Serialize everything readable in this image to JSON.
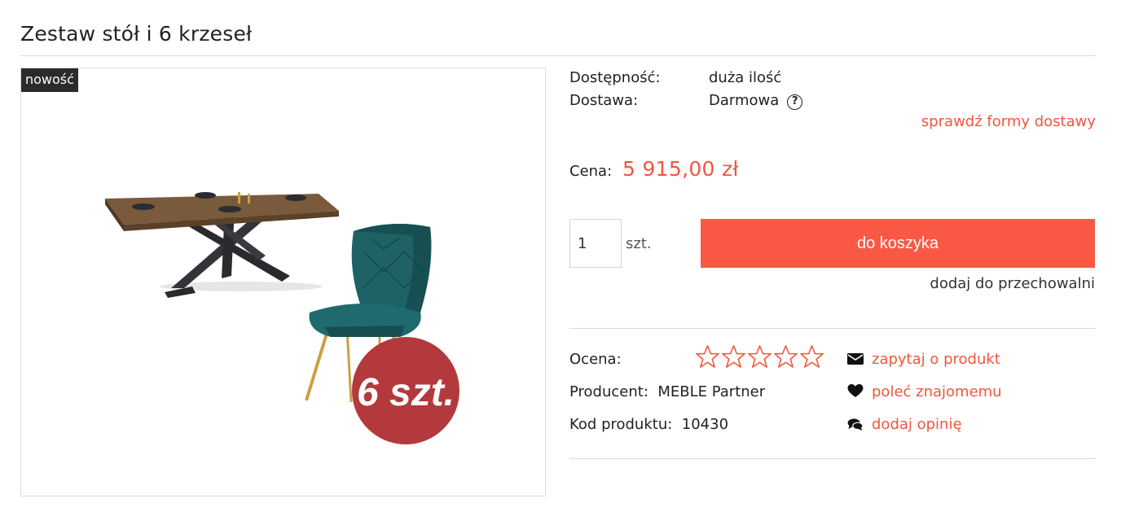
{
  "product": {
    "title": "Zestaw stół i 6 krzeseł",
    "badge": "nowość",
    "image_overlay": "6 szt."
  },
  "availability": {
    "label": "Dostępność:",
    "value": "duża ilość"
  },
  "delivery": {
    "label": "Dostawa:",
    "value": "Darmowa",
    "help_icon": "question-circle-icon",
    "link": "sprawdź formy dostawy"
  },
  "price": {
    "label": "Cena:",
    "value": "5 915,00 zł"
  },
  "purchase": {
    "quantity": "1",
    "unit": "szt.",
    "cart_button": "do koszyka",
    "store_link": "dodaj do przechowalni"
  },
  "details": {
    "rating_label": "Ocena:",
    "rating": 0,
    "rating_max": 5,
    "producer_label": "Producent:",
    "producer": "MEBLE Partner",
    "code_label": "Kod produktu:",
    "code": "10430"
  },
  "actions": [
    {
      "label": "zapytaj o produkt",
      "icon": "envelope-icon"
    },
    {
      "label": "poleć znajomemu",
      "icon": "heart-icon"
    },
    {
      "label": "dodaj opinię",
      "icon": "comments-icon"
    }
  ],
  "colors": {
    "accent": "#f95944",
    "link": "#f1563f",
    "badge_bg": "#2b2b2b",
    "overlay_badge": "#b3393c",
    "chair": "#1e6266"
  }
}
